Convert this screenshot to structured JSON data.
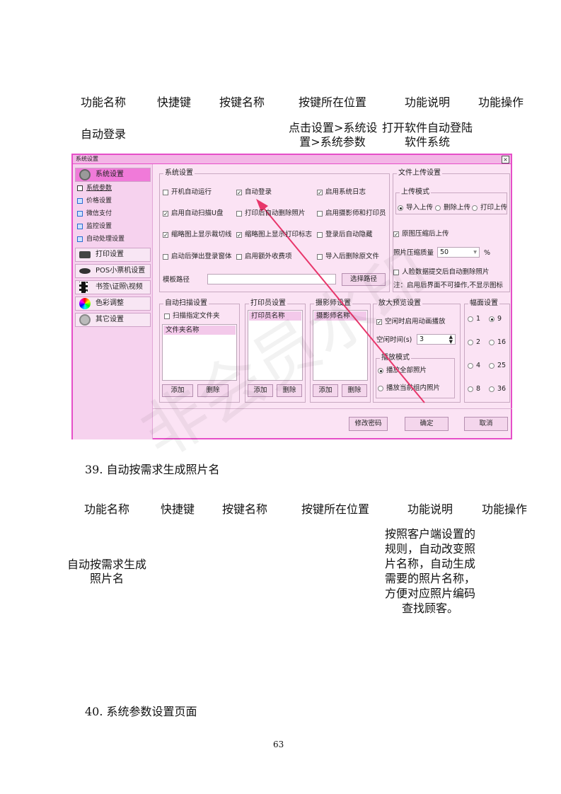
{
  "table1": {
    "headers": [
      "功能名称",
      "快捷键",
      "按键名称",
      "按键所在位置",
      "功能说明",
      "功能操作"
    ],
    "row": {
      "name": "自动登录",
      "location_line1": "点击设置>系统设",
      "location_line2": "置>系统参数",
      "desc_line1": "打开软件自动登陆",
      "desc_line2": "软件系统"
    }
  },
  "screenshot": {
    "window_title": "系统设置",
    "close_glyph": "×",
    "sidebar": {
      "items": [
        {
          "label": "系统设置",
          "icon": "gear-icon"
        },
        {
          "label": "打印设置",
          "icon": "printer-icon"
        },
        {
          "label": "POS小票机设置",
          "icon": "receipt-printer-icon"
        },
        {
          "label": "书签\\证照\\视频",
          "icon": "film-icon"
        },
        {
          "label": "色彩调整",
          "icon": "color-wheel-icon"
        },
        {
          "label": "其它设置",
          "icon": "settings-icon"
        }
      ],
      "subitems": [
        "系统参数",
        "价格设置",
        "微信支付",
        "监控设置",
        "自动处理设置"
      ]
    },
    "system_settings": {
      "title": "系统设置",
      "checkboxes": [
        {
          "label": "开机自动运行",
          "checked": false
        },
        {
          "label": "自动登录",
          "checked": true
        },
        {
          "label": "启用系统日志",
          "checked": true
        },
        {
          "label": "启用自动扫描U盘",
          "checked": true
        },
        {
          "label": "打印后自动删除照片",
          "checked": false
        },
        {
          "label": "启用摄影师和打印员",
          "checked": false
        },
        {
          "label": "缩略图上显示裁切线",
          "checked": true
        },
        {
          "label": "缩略图上显示打印标志",
          "checked": true
        },
        {
          "label": "登录后自动隐藏",
          "checked": false
        },
        {
          "label": "启动后弹出登录窗体",
          "checked": false
        },
        {
          "label": "启用额外收费项",
          "checked": false
        },
        {
          "label": "导入后删除原文件",
          "checked": false
        }
      ],
      "template_path_label": "模板路径",
      "template_path_value": "",
      "choose_path_button": "选择路径"
    },
    "upload": {
      "title": "文件上传设置",
      "mode_title": "上传模式",
      "modes": [
        {
          "label": "导入上传",
          "selected": true
        },
        {
          "label": "删除上传",
          "selected": false
        },
        {
          "label": "打印上传",
          "selected": false
        }
      ],
      "compress_label": "原图压缩后上传",
      "compress_checked": true,
      "quality_label": "照片压缩质量",
      "quality_value": "50",
      "quality_unit": "%",
      "face_delete_label": "人脸数据提交后自动删除照片",
      "face_delete_checked": false,
      "note": "注：启用后界面不可操作,不显示图标"
    },
    "auto_scan": {
      "title": "自动扫描设置",
      "check_label": "扫描指定文件夹",
      "column": "文件夹名称",
      "add": "添加",
      "delete": "删除"
    },
    "printer_settings": {
      "title": "打印员设置",
      "column": "打印员名称",
      "add": "添加",
      "delete": "删除"
    },
    "photographer_settings": {
      "title": "摄影师设置",
      "column": "摄影师名称",
      "add": "添加",
      "delete": "删除"
    },
    "preview": {
      "title": "放大预览设置",
      "idle_anim_label": "空闲时启用动画播放",
      "idle_anim_checked": true,
      "idle_time_label": "空闲时间(s)",
      "idle_time_value": "3",
      "play_mode_title": "播放模式",
      "play_modes": [
        {
          "label": "播放全部照片",
          "selected": true
        },
        {
          "label": "播放当前组内照片",
          "selected": false
        }
      ]
    },
    "layout": {
      "title": "幅面设置",
      "options": [
        {
          "label": "1",
          "selected": false
        },
        {
          "label": "9",
          "selected": true
        },
        {
          "label": "2",
          "selected": false
        },
        {
          "label": "16",
          "selected": false
        },
        {
          "label": "4",
          "selected": false
        },
        {
          "label": "25",
          "selected": false
        },
        {
          "label": "8",
          "selected": false
        },
        {
          "label": "36",
          "selected": false
        }
      ]
    },
    "footer_buttons": {
      "change_password": "修改密码",
      "ok": "确定",
      "cancel": "取消"
    },
    "watermark": "非会员水印",
    "colors": {
      "accent": "#e64fc8",
      "arrow": "#e8366b",
      "panel": "#fbe3f4"
    }
  },
  "section39_title": "39. 自动按需求生成照片名",
  "table2": {
    "headers": [
      "功能名称",
      "快捷键",
      "按键名称",
      "按键所在位置",
      "功能说明",
      "功能操作"
    ],
    "row": {
      "name_line1": "自动按需求生成",
      "name_line2": "照片名",
      "desc_lines": [
        "按照客户端设置的",
        "规则，自动改变照",
        "片名称，自动生成",
        "需要的照片名称，",
        "方便对应照片编码",
        "查找顾客。"
      ]
    }
  },
  "section40_title": "40. 系统参数设置页面",
  "page_number": "63"
}
